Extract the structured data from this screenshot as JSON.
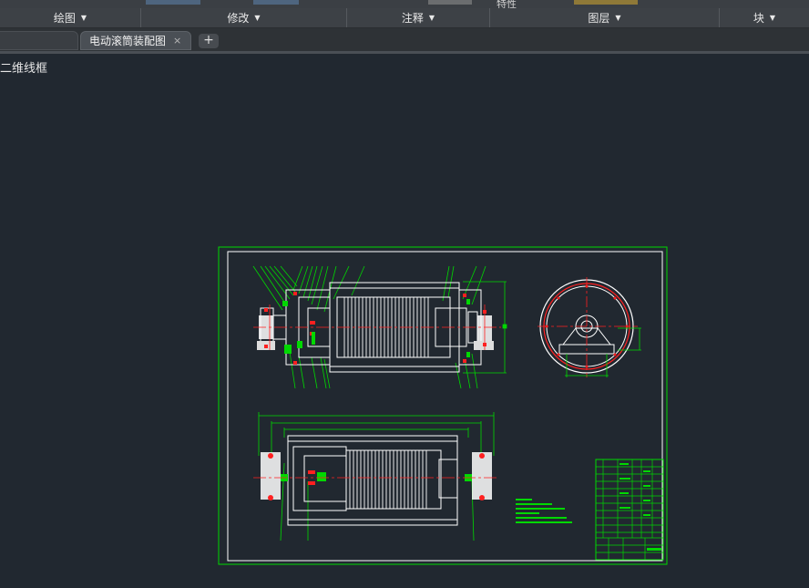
{
  "ribbon": {
    "top_labels": [
      "特性"
    ],
    "panels": [
      {
        "label": "绘图"
      },
      {
        "label": "修改"
      },
      {
        "label": "注释"
      },
      {
        "label": "图层"
      },
      {
        "label": "块"
      }
    ]
  },
  "tabs": {
    "active_label": "电动滚筒装配图",
    "close_glyph": "×",
    "new_glyph": "+"
  },
  "viewport": {
    "label": "二维线框"
  },
  "colors": {
    "background": "#212830",
    "frame": "#00d800",
    "outline": "#ffffff",
    "centerline": "#ff2020"
  }
}
